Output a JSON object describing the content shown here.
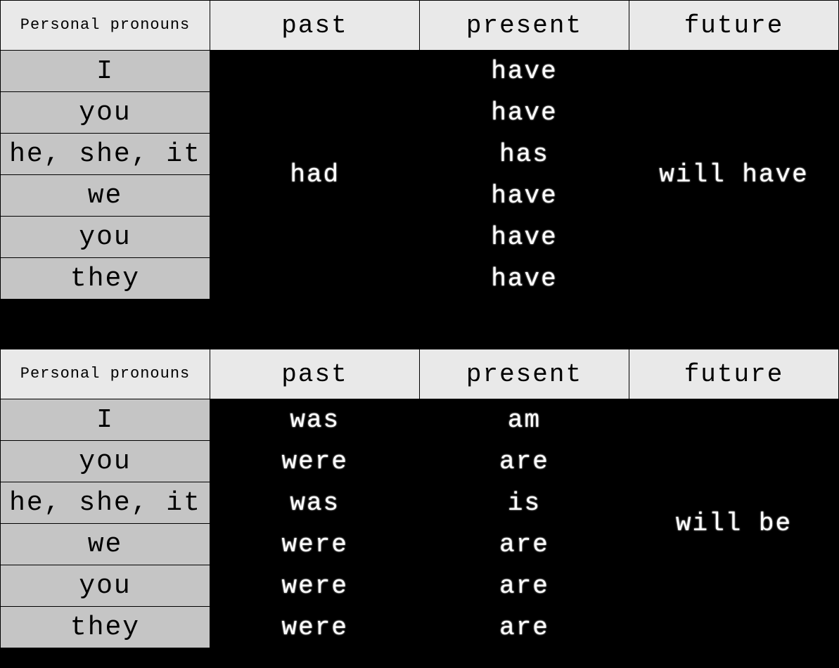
{
  "headers": {
    "col1": "Personal pronouns",
    "col2": "past",
    "col3": "present",
    "col4": "future"
  },
  "pronouns": [
    "I",
    "you",
    "he, she, it",
    "we",
    "you",
    "they"
  ],
  "table1": {
    "past": "had",
    "present": [
      "have",
      "have",
      "has",
      "have",
      "have",
      "have"
    ],
    "future": "will have"
  },
  "table2": {
    "past": [
      "was",
      "were",
      "was",
      "were",
      "were",
      "were"
    ],
    "present": [
      "am",
      "are",
      "is",
      "are",
      "are",
      "are"
    ],
    "future": "will be"
  }
}
